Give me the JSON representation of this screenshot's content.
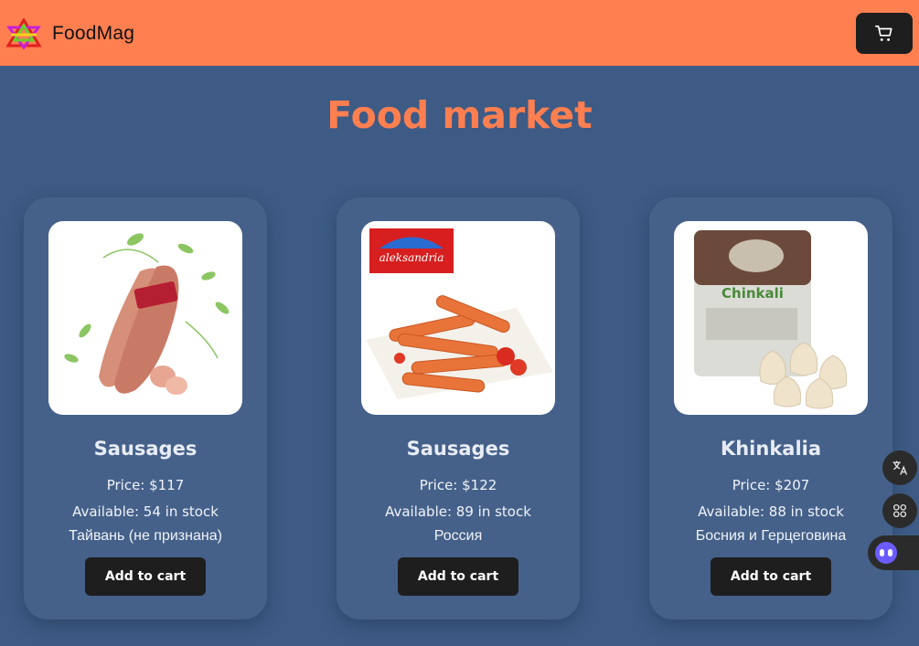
{
  "header": {
    "brand": "FoodMag",
    "logo_icon": "crown-star-logo-icon",
    "cart_icon": "shopping-cart-icon"
  },
  "page": {
    "title": "Food market"
  },
  "products": [
    {
      "name": "Sausages",
      "price": "Price: $117",
      "stock": "Available: 54 in stock",
      "country": "Тайвань (не признана)",
      "add_label": "Add to cart",
      "image": "sausage-links-image"
    },
    {
      "name": "Sausages",
      "price": "Price: $122",
      "stock": "Available: 89 in stock",
      "country": "Россия",
      "add_label": "Add to cart",
      "image": "aleksandria-sausages-image",
      "image_label": "aleksandria"
    },
    {
      "name": "Khinkalia",
      "price": "Price: $207",
      "stock": "Available: 88 in stock",
      "country": "Босния и Герцеговина",
      "add_label": "Add to cart",
      "image": "khinkali-dumplings-image",
      "image_label": "Chinkali"
    }
  ],
  "floating": {
    "translate_icon": "translate-icon",
    "apps_icon": "apps-grid-icon",
    "assistant_icon": "assistant-face-icon"
  },
  "colors": {
    "header": "#ff7f50",
    "background": "#3d5b85",
    "card": "#45618a",
    "title": "#ff7f50",
    "button": "#1e1e1e"
  }
}
